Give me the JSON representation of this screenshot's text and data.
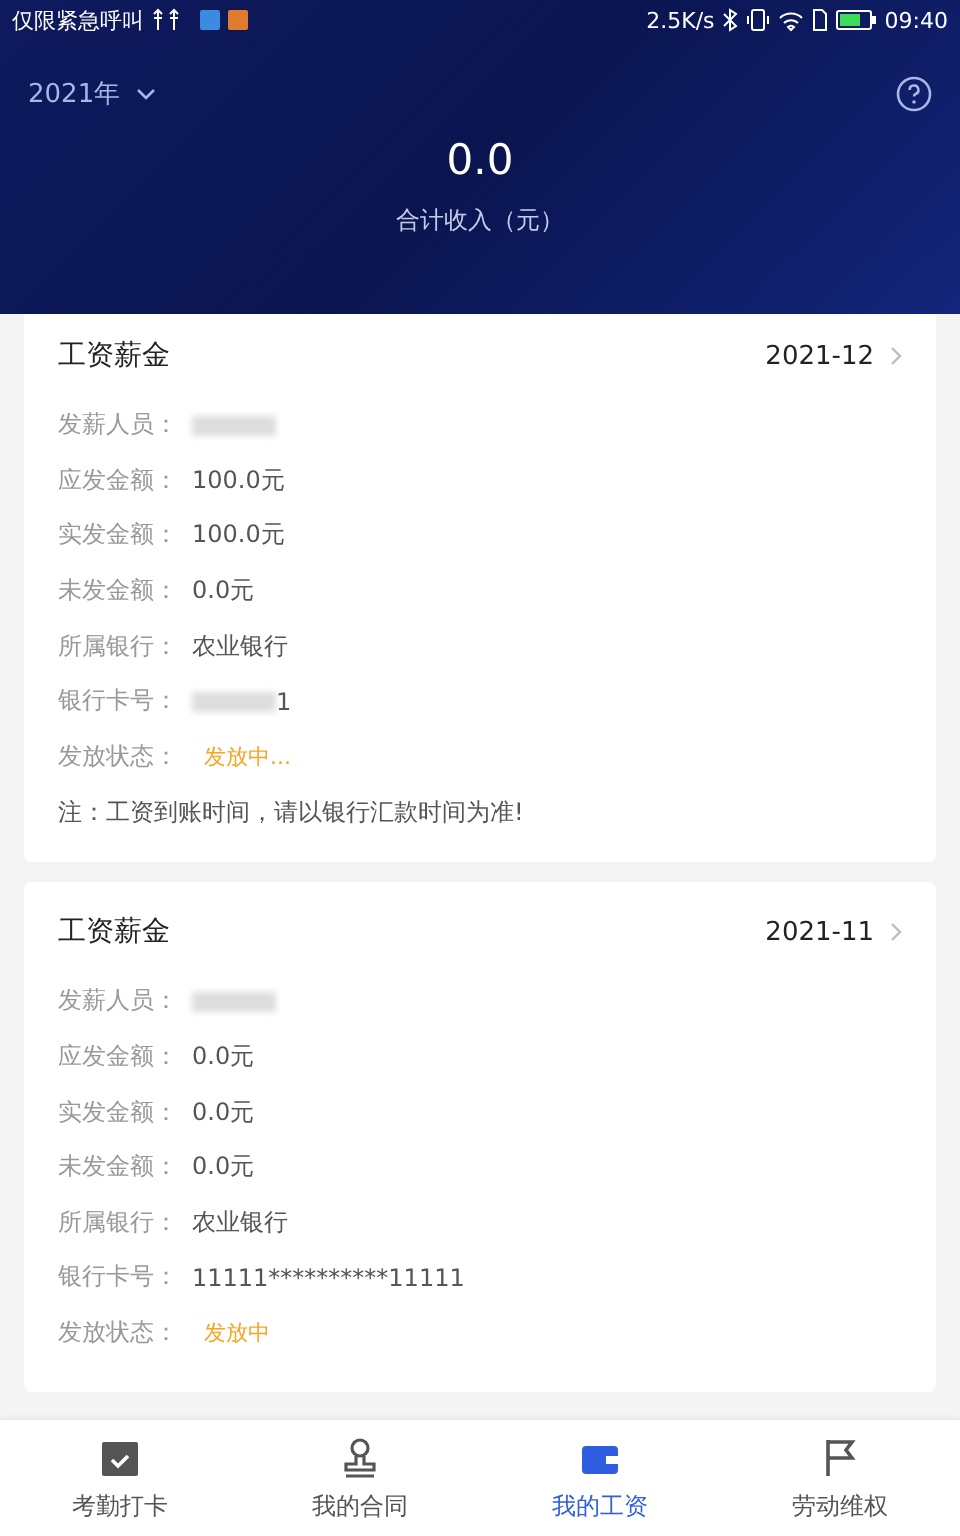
{
  "status_bar": {
    "notifications": "仅限紧急呼叫",
    "speed": "2.5K/s",
    "time": "09:40"
  },
  "header": {
    "year": "2021年",
    "total": "0.0",
    "total_label": "合计收入（元）"
  },
  "cards": [
    {
      "title": "工资薪金",
      "month": "2021-12",
      "rows": [
        {
          "label": "发薪人员：",
          "kind": "masked"
        },
        {
          "label": "应发金额：",
          "value": "100.0元",
          "kind": "plain"
        },
        {
          "label": "实发金额：",
          "value": "100.0元",
          "kind": "plain"
        },
        {
          "label": "未发金额：",
          "value": "0.0元",
          "kind": "plain"
        },
        {
          "label": "所属银行：",
          "value": "农业银行",
          "kind": "plain"
        },
        {
          "label": "银行卡号：",
          "value": "1",
          "kind": "masked"
        },
        {
          "label": "发放状态：",
          "value": "发放中...",
          "kind": "status"
        }
      ],
      "note": "注：工资到账时间，请以银行汇款时间为准!"
    },
    {
      "title": "工资薪金",
      "month": "2021-11",
      "rows": [
        {
          "label": "发薪人员：",
          "kind": "masked"
        },
        {
          "label": "应发金额：",
          "value": "0.0元",
          "kind": "plain"
        },
        {
          "label": "实发金额：",
          "value": "0.0元",
          "kind": "plain"
        },
        {
          "label": "未发金额：",
          "value": "0.0元",
          "kind": "plain"
        },
        {
          "label": "所属银行：",
          "value": "农业银行",
          "kind": "plain"
        },
        {
          "label": "银行卡号：",
          "value": "11111**********11111",
          "kind": "plain"
        },
        {
          "label": "发放状态：",
          "value": "发放中",
          "kind": "status"
        }
      ]
    }
  ],
  "tabs": [
    {
      "label": "考勤打卡",
      "selected": false
    },
    {
      "label": "我的合同",
      "selected": false
    },
    {
      "label": "我的工资",
      "selected": true
    },
    {
      "label": "劳动维权",
      "selected": false
    }
  ]
}
